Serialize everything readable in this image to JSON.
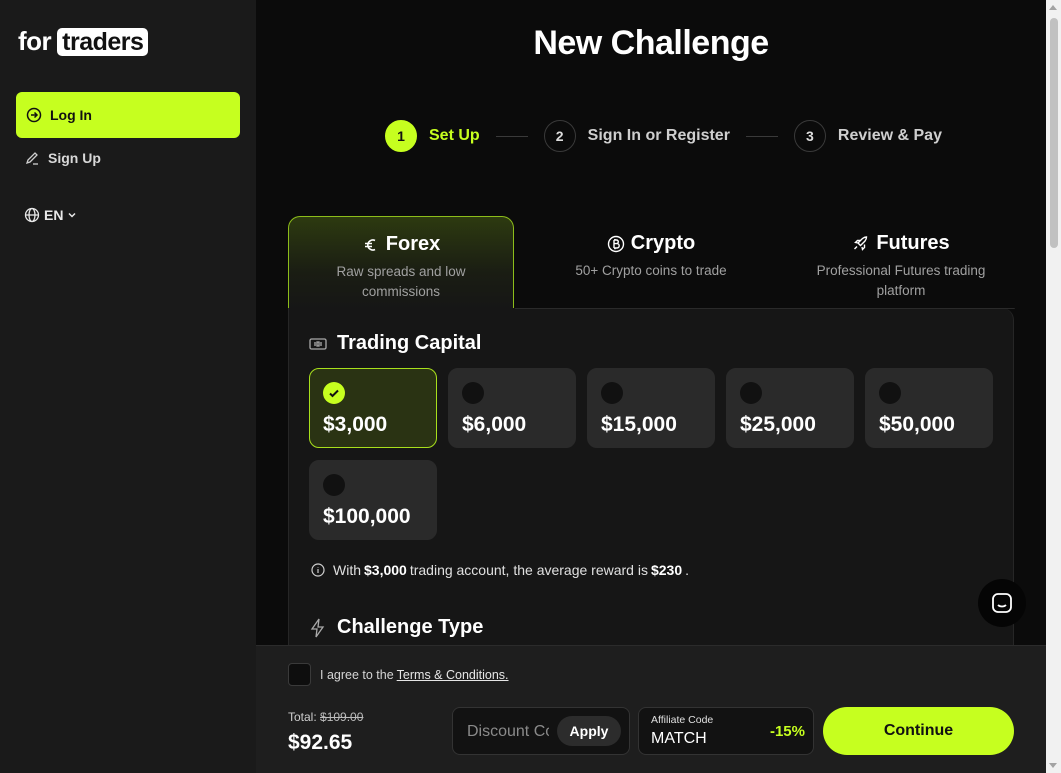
{
  "sidebar": {
    "logo_for": "for",
    "logo_traders": "traders",
    "login_label": "Log In",
    "signup_label": "Sign Up",
    "language": "EN"
  },
  "page_title": "New Challenge",
  "steps": [
    {
      "num": "1",
      "label": "Set Up",
      "active": true
    },
    {
      "num": "2",
      "label": "Sign In or Register",
      "active": false
    },
    {
      "num": "3",
      "label": "Review & Pay",
      "active": false
    }
  ],
  "tabs": [
    {
      "title": "Forex",
      "desc": "Raw spreads and low commissions",
      "icon": "euro-icon"
    },
    {
      "title": "Crypto",
      "desc": "50+ Crypto coins to trade",
      "icon": "bitcoin-icon"
    },
    {
      "title": "Futures",
      "desc": "Professional Futures trading platform",
      "icon": "rocket-icon"
    }
  ],
  "trading_capital": {
    "heading": "Trading Capital",
    "options": [
      "$3,000",
      "$6,000",
      "$15,000",
      "$25,000",
      "$50,000",
      "$100,000"
    ],
    "selected": "$3,000",
    "info": {
      "prefix": "With",
      "amount": "$3,000",
      "middle": "trading account, the average reward is",
      "reward": "$230",
      "suffix": "."
    }
  },
  "challenge_type": {
    "heading": "Challenge Type"
  },
  "footer": {
    "agree_text": "I agree to the",
    "terms_link": "Terms & Conditions.",
    "total_label": "Total:",
    "original_price": "$109.00",
    "total": "$92.65",
    "discount_placeholder": "Discount Code",
    "apply_label": "Apply",
    "affiliate_label": "Affiliate Code",
    "affiliate_code": "MATCH",
    "affiliate_discount": "-15%",
    "continue_label": "Continue"
  },
  "colors": {
    "accent": "#c6ff1f",
    "sidebar_bg": "#1a1a1a",
    "main_bg": "#0b0b0b"
  }
}
